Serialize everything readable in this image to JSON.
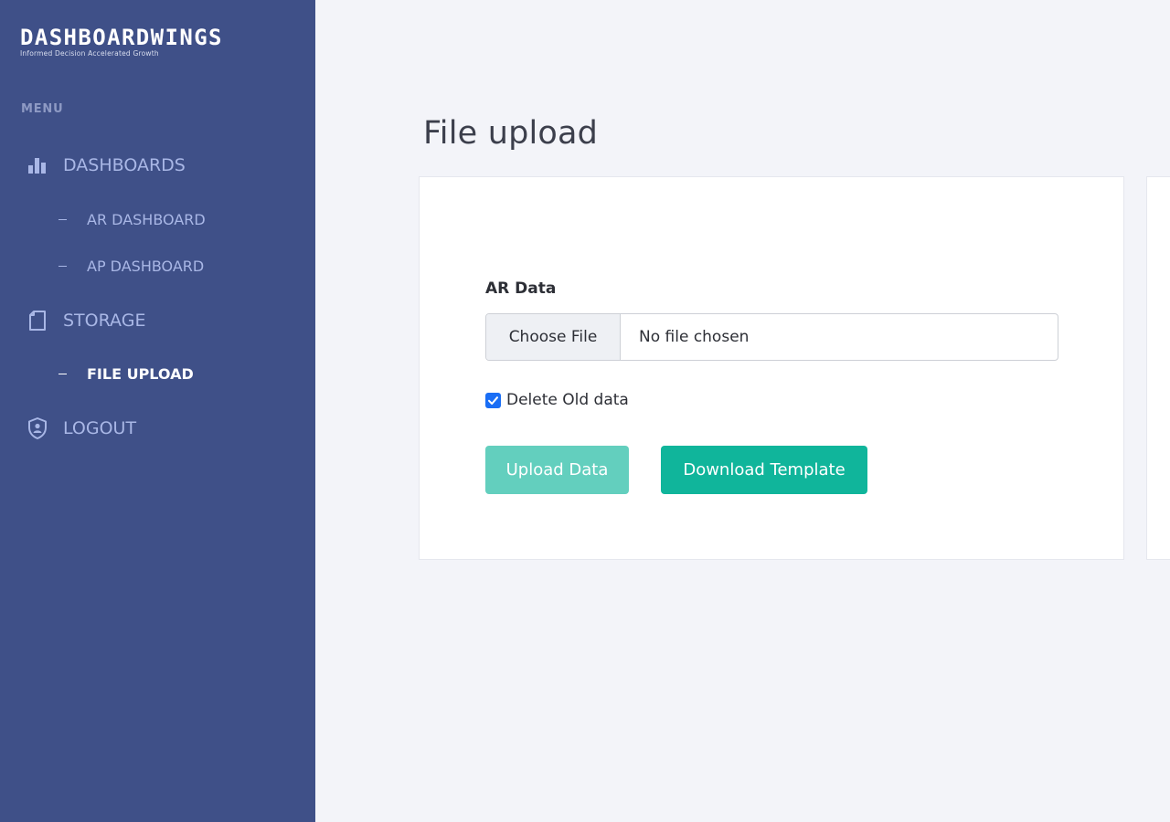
{
  "brand": {
    "name": "DASHBOARDWINGS",
    "tagline": "Informed Decision Accelerated Growth"
  },
  "sidebar": {
    "menu_label": "MENU",
    "sections": [
      {
        "label": "DASHBOARDS",
        "icon": "bar-chart-icon",
        "items": [
          {
            "label": "AR DASHBOARD"
          },
          {
            "label": "AP DASHBOARD"
          }
        ]
      },
      {
        "label": "STORAGE",
        "icon": "file-icon",
        "items": [
          {
            "label": "FILE UPLOAD",
            "active": true
          }
        ]
      },
      {
        "label": "LOGOUT",
        "icon": "user-shield-icon",
        "items": []
      }
    ]
  },
  "main": {
    "title": "File upload",
    "form": {
      "field_label": "AR Data",
      "choose_file_label": "Choose File",
      "file_status": "No file chosen",
      "delete_old": {
        "label": "Delete Old data",
        "checked": true
      },
      "upload_button": "Upload Data",
      "download_button": "Download Template"
    }
  },
  "colors": {
    "sidebar_bg": "#3f5088",
    "nav_text": "#a9b7e6",
    "accent": "#10b59b",
    "accent_disabled": "#63cfbe",
    "page_bg": "#f3f4f9"
  }
}
